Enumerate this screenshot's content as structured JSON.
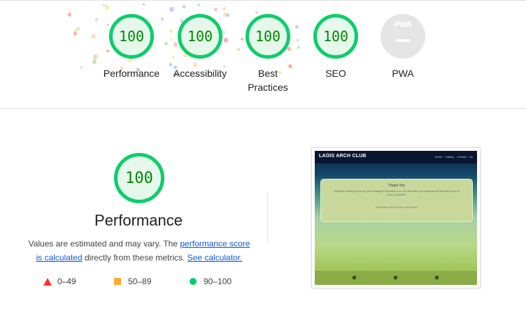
{
  "scores": [
    {
      "value": "100",
      "label": "Performance"
    },
    {
      "value": "100",
      "label": "Accessibility"
    },
    {
      "value": "100",
      "label": "Best Practices"
    },
    {
      "value": "100",
      "label": "SEO"
    }
  ],
  "pwa": {
    "badge": "PWA",
    "label": "PWA"
  },
  "main": {
    "score": "100",
    "title": "Performance",
    "desc_prefix": "Values are estimated and may vary. The ",
    "link1": "performance score is calculated",
    "desc_mid": " directly from these metrics. ",
    "link2": "See calculator."
  },
  "legend": [
    {
      "range": "0–49",
      "color": "#ff3333"
    },
    {
      "range": "50–89",
      "color": "#ffaa33"
    },
    {
      "range": "90–100",
      "color": "#00cc66"
    }
  ],
  "thumbnail": {
    "brand": "LAOIS ARCH CLUB",
    "nav_links": "Home  Gallery  Contact Us",
    "card_title": "Thank You",
    "card_body": "Thanks for reaching out to us, your message is important to us. We will review your message and get back to you as soon as possible.",
    "card_note": "Meanwhile check out our social media"
  },
  "colors": {
    "pass": "#0cce6b",
    "pass_text": "#008800",
    "pass_bg": "#e6f7ec",
    "link": "#0b57d0"
  }
}
